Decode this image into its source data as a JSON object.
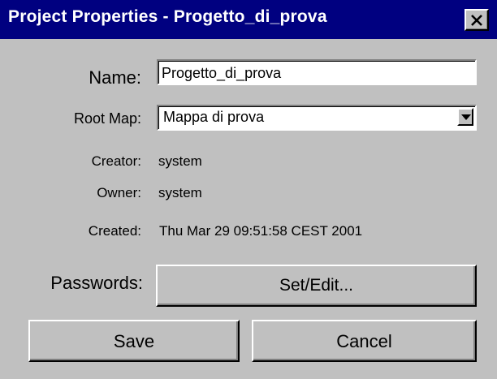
{
  "window": {
    "title": "Project Properties - Progetto_di_prova",
    "close_icon": "close-x-icon"
  },
  "form": {
    "name_label": "Name:",
    "name_value": "Progetto_di_prova",
    "rootmap_label": "Root Map:",
    "rootmap_value": "Mappa di prova",
    "creator_label": "Creator:",
    "creator_value": "system",
    "owner_label": "Owner:",
    "owner_value": "system",
    "created_label": "Created:",
    "created_value": "Thu Mar 29 09:51:58 CEST 2001",
    "passwords_label": "Passwords:",
    "set_edit_label": "Set/Edit..."
  },
  "buttons": {
    "save_label": "Save",
    "cancel_label": "Cancel"
  },
  "colors": {
    "titlebar": "#000080",
    "dialog_bg": "#c0c0c0"
  }
}
